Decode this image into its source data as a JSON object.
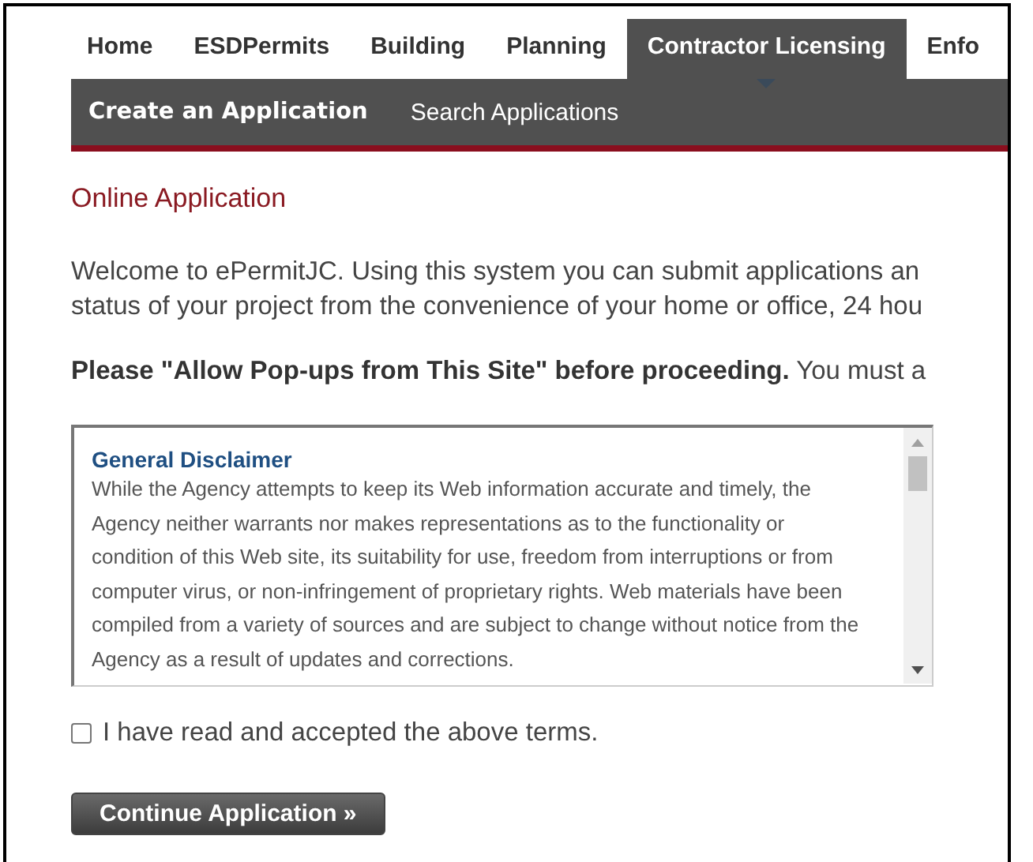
{
  "main_nav": [
    {
      "label": "Home",
      "selected": false
    },
    {
      "label": "ESDPermits",
      "selected": false
    },
    {
      "label": "Building",
      "selected": false
    },
    {
      "label": "Planning",
      "selected": false
    },
    {
      "label": "Contractor Licensing",
      "selected": true
    },
    {
      "label": "Enfo",
      "selected": false
    }
  ],
  "sub_nav": [
    {
      "label": "Create an Application",
      "selected": true
    },
    {
      "label": "Search Applications",
      "selected": false
    }
  ],
  "page_title": "Online Application",
  "intro_lines": [
    "Welcome to ePermitJC. Using this system you can submit applications an",
    "status of your project from the convenience of your home or office, 24 hou"
  ],
  "notice": "**Please \"Allow Pop-ups from This Site\" before proceeding.** You must a",
  "disclaimer": {
    "title": "General Disclaimer",
    "text": "While the Agency attempts to keep its Web information accurate and timely, the Agency neither warrants nor makes representations as to the functionality or condition of this Web site, its suitability for use, freedom from interruptions or from computer virus, or non-infringement of proprietary rights. Web materials have been compiled from a variety of sources and are subject to change without notice from the Agency as a result of updates and corrections."
  },
  "terms": {
    "label": "I have read and accepted the above terms.",
    "checked": false
  },
  "continue_button": "Continue Application »"
}
